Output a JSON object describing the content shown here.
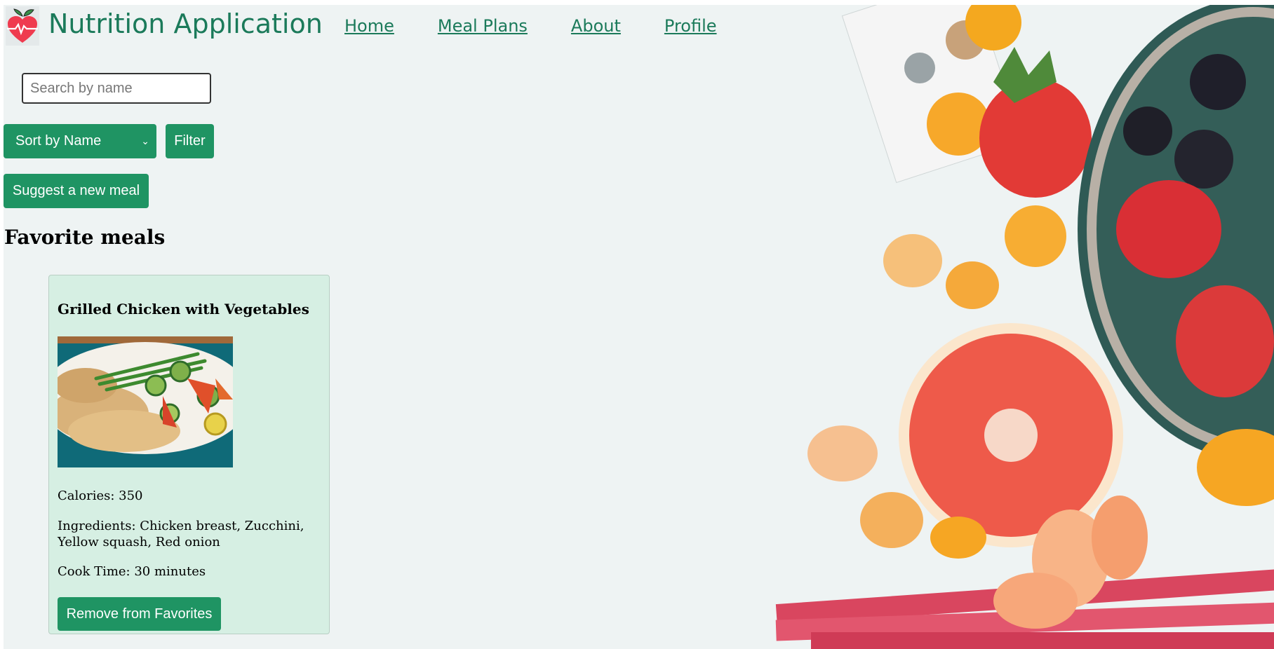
{
  "header": {
    "app_title": "Nutrition Application",
    "logo_icon": "heart-pulse-apple-icon",
    "nav": [
      {
        "label": "Home"
      },
      {
        "label": "Meal Plans"
      },
      {
        "label": "About"
      },
      {
        "label": "Profile"
      }
    ]
  },
  "controls": {
    "search_placeholder": "Search by name",
    "search_value": "",
    "sort_selected": "Sort by Name",
    "filter_label": "Filter",
    "suggest_label": "Suggest a new meal"
  },
  "favorites": {
    "heading": "Favorite meals",
    "meals": [
      {
        "title": "Grilled Chicken with Vegetables",
        "calories": "Calories: 350",
        "ingredients": "Ingredients: Chicken breast, Zucchini, Yellow squash, Red onion",
        "cook_time": "Cook Time: 30 minutes",
        "remove_label": "Remove from Favorites"
      }
    ]
  },
  "colors": {
    "brand": "#1b7a5a",
    "button": "#1f9463",
    "card_bg": "#d6efe3",
    "page_bg": "#eef3f3"
  }
}
